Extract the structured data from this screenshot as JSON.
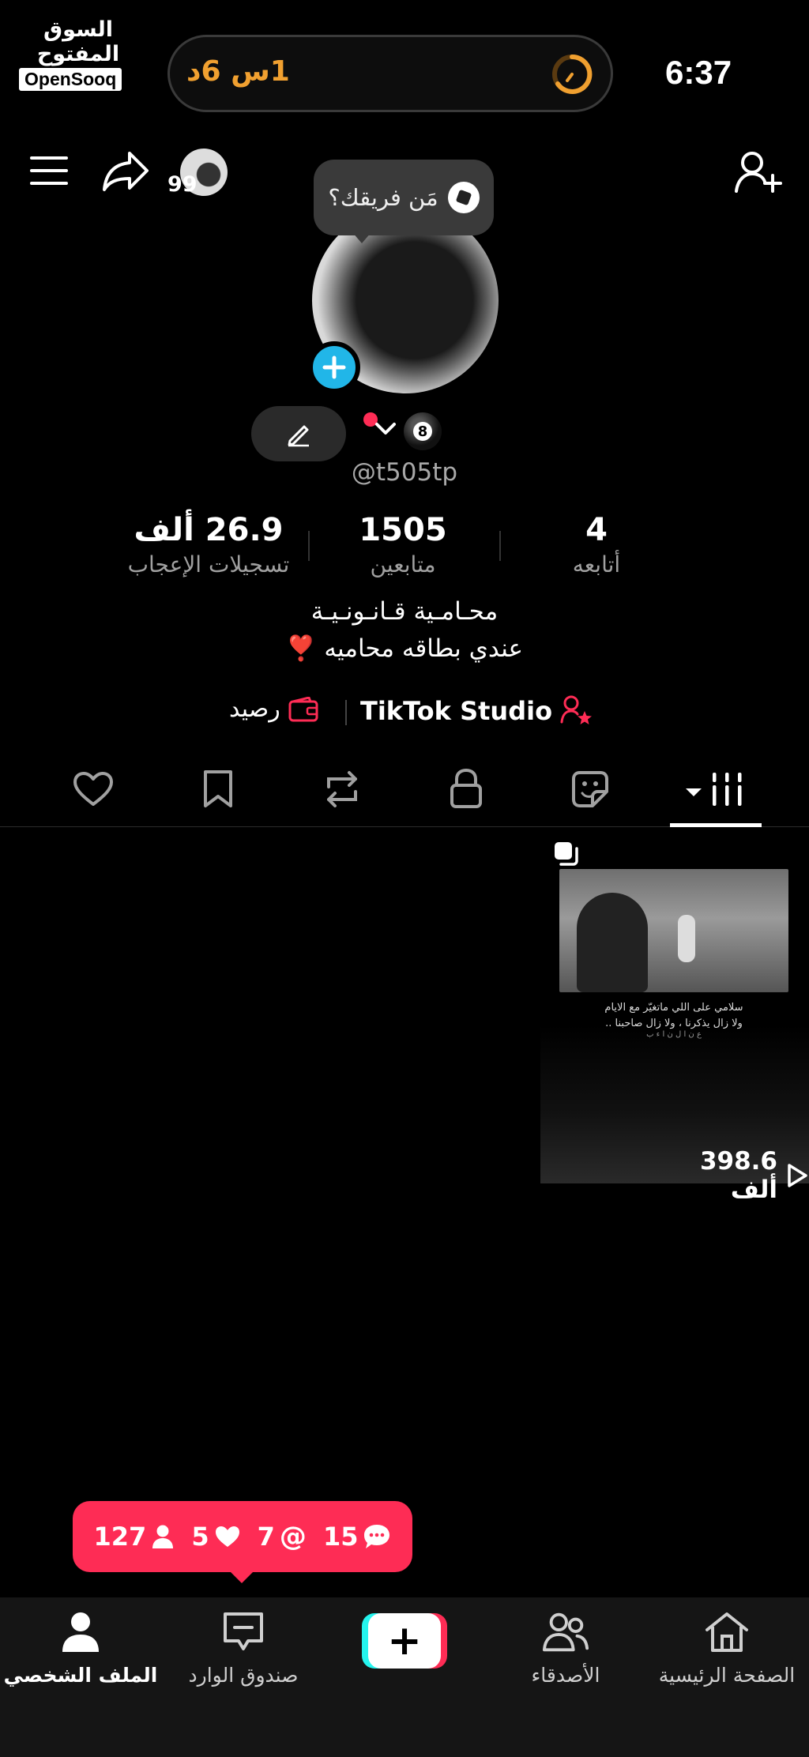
{
  "status_bar": {
    "time": "6:37",
    "screen_time": "1س 6د"
  },
  "watermark": {
    "arabic": "السوق المفتوح",
    "english": "OpenSooq"
  },
  "top_nav": {
    "story_count": "99",
    "avatar_bubble": "مَن فريقك؟"
  },
  "profile": {
    "username": "@t505tp",
    "pool_ball_number": "8",
    "stats": [
      {
        "value": "26.9 ألف",
        "label": "تسجيلات الإعجاب"
      },
      {
        "value": "1505",
        "label": "متابعين"
      },
      {
        "value": "4",
        "label": "أتابعه"
      }
    ],
    "bio_lines": [
      "محـامـية قـانـونـيـة",
      "عندي بطاقه محاميه ❣️"
    ],
    "studio_label": "TikTok Studio",
    "balance_label": "رصيد"
  },
  "video": {
    "caption_line1": "سلامي على اللي ماتغيّر مع الايام",
    "caption_line2": "ولا زال يذكرنا ، ولا زال صاحبنا ..",
    "caption_sub": "ﻉ ﻥ ﺍ ﻝ ﻥ ﺍ ﺀ ﺏ",
    "views": "398.6 ألف"
  },
  "notifications": {
    "comments": "15",
    "mentions": "7",
    "likes": "5",
    "followers": "127"
  },
  "bottom_nav": {
    "home": "الصفحة الرئيسية",
    "friends": "الأصدقاء",
    "create": "+",
    "inbox": "صندوق الوارد",
    "profile": "الملف الشخصي"
  },
  "colors": {
    "accent": "#fe2c55",
    "cyan": "#25f4ee",
    "avatar_plus": "#21b6e8",
    "timer": "#f0a030"
  }
}
